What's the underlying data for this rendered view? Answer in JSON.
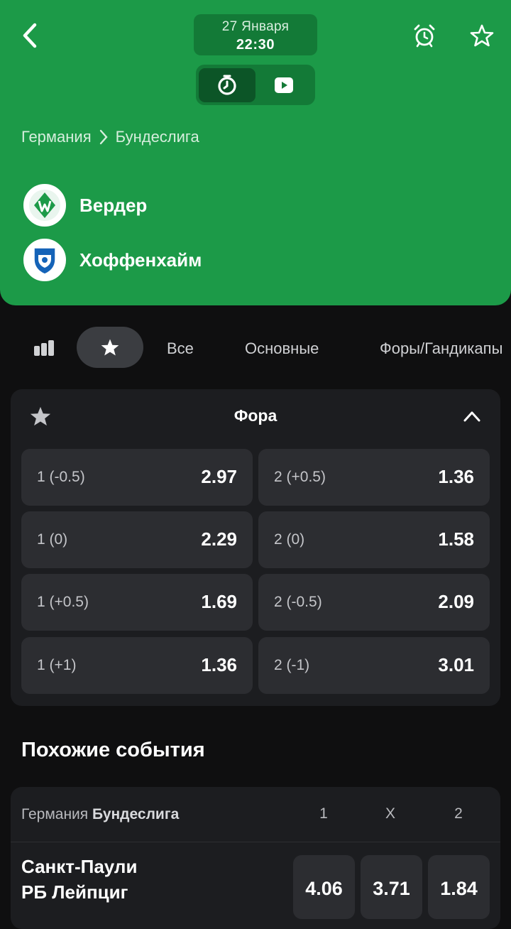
{
  "header": {
    "date": "27 Января",
    "time": "22:30",
    "breadcrumb": {
      "country": "Германия",
      "league": "Бундеслига"
    },
    "teams": [
      {
        "name": "Вердер"
      },
      {
        "name": "Хоффенхайм"
      }
    ]
  },
  "tabs": {
    "all": "Все",
    "main": "Основные",
    "handicap": "Форы/Гандикапы"
  },
  "market": {
    "title": "Фора",
    "odds": [
      {
        "label": "1 (-0.5)",
        "value": "2.97"
      },
      {
        "label": "2 (+0.5)",
        "value": "1.36"
      },
      {
        "label": "1 (0)",
        "value": "2.29"
      },
      {
        "label": "2 (0)",
        "value": "1.58"
      },
      {
        "label": "1 (+0.5)",
        "value": "1.69"
      },
      {
        "label": "2 (-0.5)",
        "value": "2.09"
      },
      {
        "label": "1 (+1)",
        "value": "1.36"
      },
      {
        "label": "2 (-1)",
        "value": "3.01"
      }
    ]
  },
  "similar": {
    "title": "Похожие события",
    "country": "Германия",
    "league": "Бундеслига",
    "cols": [
      "1",
      "X",
      "2"
    ],
    "event": {
      "team1": "Санкт-Паули",
      "team2": "РБ Лейпциг",
      "odds": [
        "4.06",
        "3.71",
        "1.84"
      ]
    }
  },
  "colors": {
    "header_green": "#1c9a48",
    "dark_green": "#137a37",
    "background": "#0f0f10",
    "card": "#1c1d20",
    "odd_cell": "#2c2d31"
  }
}
